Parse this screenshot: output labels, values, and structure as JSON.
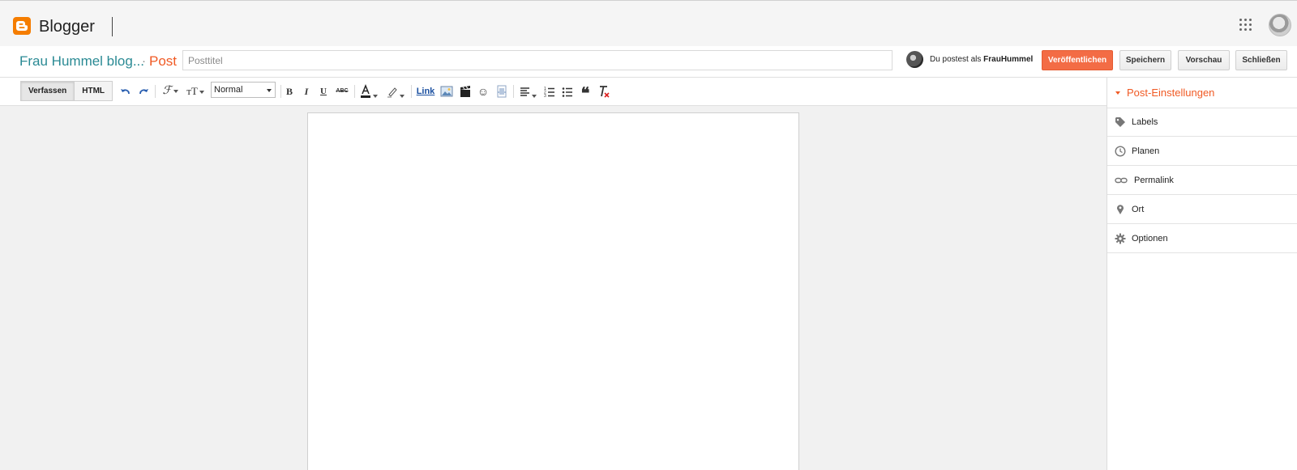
{
  "app": {
    "brand": "Blogger",
    "brand_color": "#f57d00"
  },
  "header": {
    "blog_name": "Frau Hummel blog...",
    "separator": "·",
    "section": "Post",
    "title_placeholder": "Posttitel",
    "poster_prefix": "Du postest als",
    "poster_name": "FrauHummel",
    "publish_label": "Veröffentlichen",
    "save_label": "Speichern",
    "preview_label": "Vorschau",
    "close_label": "Schließen",
    "publish_color": "#f36c45"
  },
  "toolbar": {
    "compose_label": "Verfassen",
    "html_label": "HTML",
    "paragraph_format": "Normal",
    "link_label": "Link",
    "icons": [
      "undo-icon",
      "redo-icon",
      "font-icon",
      "font-size-icon",
      "bold-icon",
      "italic-icon",
      "underline-icon",
      "strikethrough-icon",
      "text-color-icon",
      "highlight-icon",
      "image-icon",
      "video-icon",
      "emoji-icon",
      "jump-break-icon",
      "align-icon",
      "numbered-list-icon",
      "bulleted-list-icon",
      "quote-icon",
      "clear-format-icon"
    ]
  },
  "sidebar": {
    "title": "Post-Einstellungen",
    "accent_color": "#f05a24",
    "items": [
      {
        "label": "Labels",
        "icon": "tag-icon"
      },
      {
        "label": "Planen",
        "icon": "clock-icon"
      },
      {
        "label": "Permalink",
        "icon": "link-icon"
      },
      {
        "label": "Ort",
        "icon": "location-pin-icon"
      },
      {
        "label": "Optionen",
        "icon": "gear-icon"
      }
    ]
  }
}
